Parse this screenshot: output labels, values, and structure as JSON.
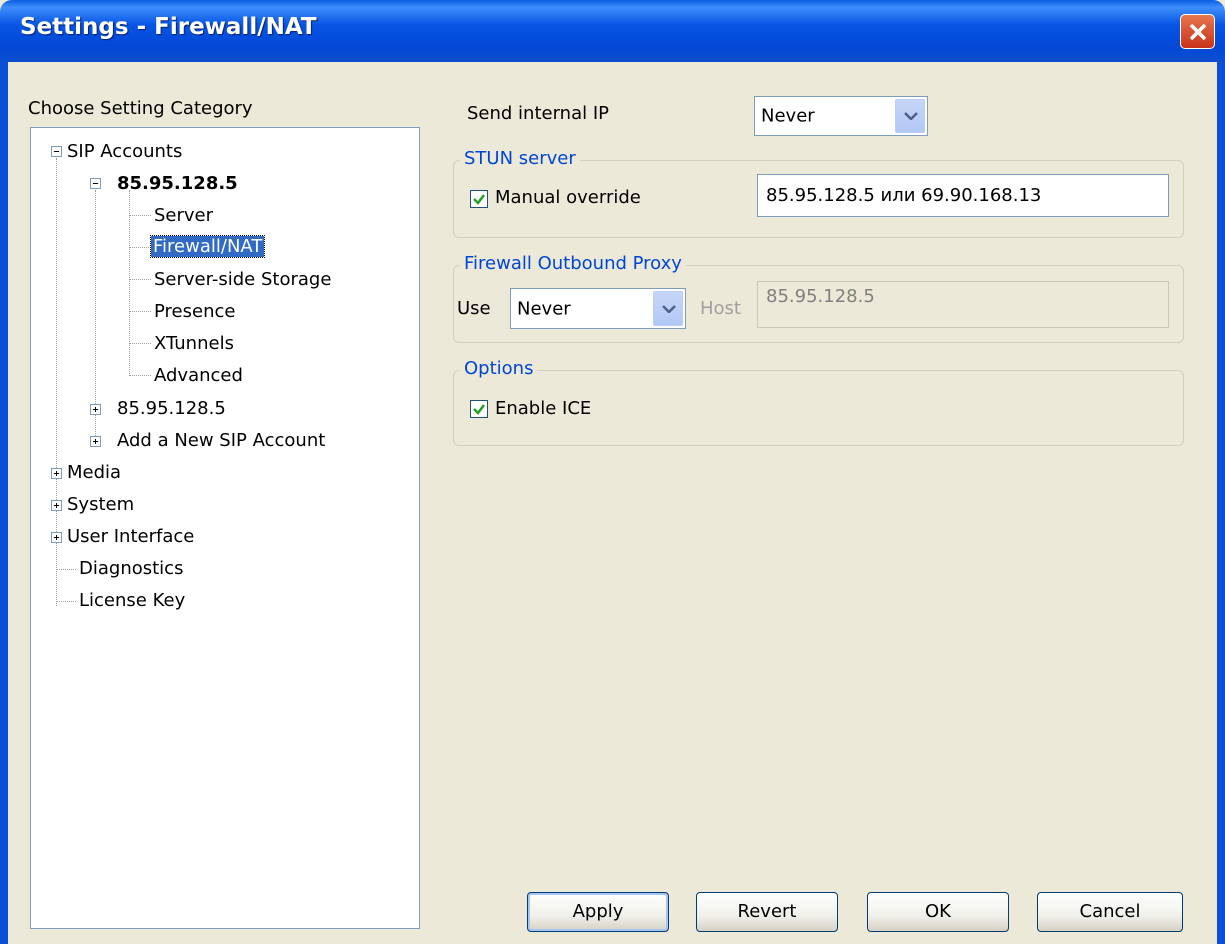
{
  "window": {
    "title": "Settings - Firewall/NAT"
  },
  "tree": {
    "heading": "Choose Setting Category",
    "items": [
      {
        "label": "SIP Accounts"
      },
      {
        "label": "85.95.128.5"
      },
      {
        "label": "Server"
      },
      {
        "label": "Firewall/NAT"
      },
      {
        "label": "Server-side Storage"
      },
      {
        "label": "Presence"
      },
      {
        "label": "XTunnels"
      },
      {
        "label": "Advanced"
      },
      {
        "label": "85.95.128.5"
      },
      {
        "label": "Add a New SIP Account"
      },
      {
        "label": "Media"
      },
      {
        "label": "System"
      },
      {
        "label": "User Interface"
      },
      {
        "label": "Diagnostics"
      },
      {
        "label": "License Key"
      }
    ]
  },
  "send_internal_ip": {
    "label": "Send internal IP",
    "value": "Never"
  },
  "stun": {
    "group_title": "STUN server",
    "override_label": "Manual override",
    "override_checked": true,
    "server_value": "85.95.128.5 или 69.90.168.13"
  },
  "proxy": {
    "group_title": "Firewall Outbound Proxy",
    "use_label": "Use",
    "use_value": "Never",
    "host_label": "Host",
    "host_value": "85.95.128.5"
  },
  "options": {
    "group_title": "Options",
    "ice_label": "Enable ICE",
    "ice_checked": true
  },
  "buttons": {
    "apply": "Apply",
    "revert": "Revert",
    "ok": "OK",
    "cancel": "Cancel"
  },
  "colors": {
    "title_bar": "#0348d6",
    "selection": "#316ac5",
    "group_title": "#0046d5",
    "face": "#ece9d8"
  }
}
